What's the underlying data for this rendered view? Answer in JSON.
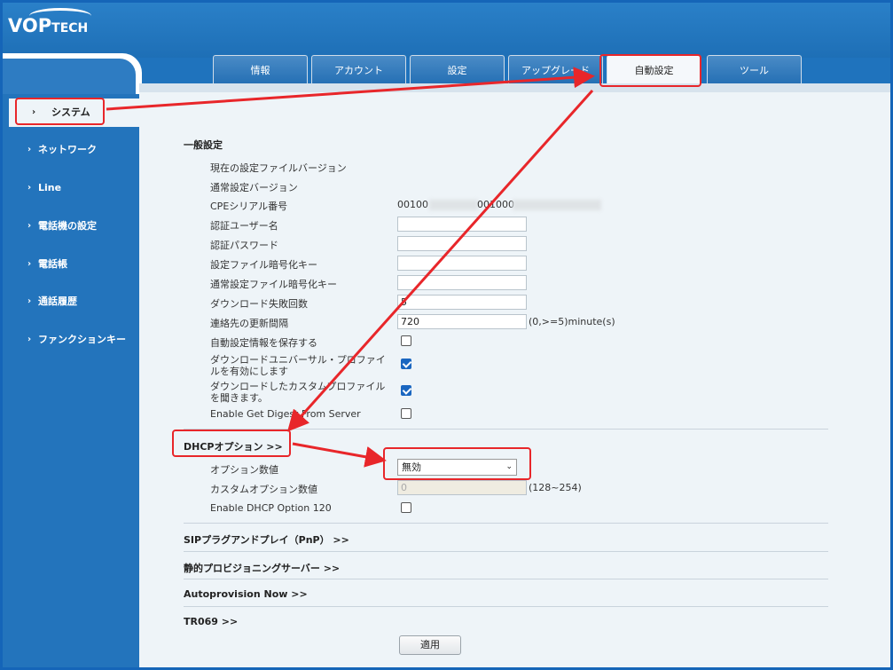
{
  "logo": {
    "main": "VOP",
    "sub": "TECH"
  },
  "tabs": [
    {
      "label": "情報"
    },
    {
      "label": "アカウント"
    },
    {
      "label": "設定"
    },
    {
      "label": "アップグレード"
    },
    {
      "label": "自動設定"
    },
    {
      "label": "ツール"
    }
  ],
  "sidebar": {
    "items": [
      {
        "label": "システム"
      },
      {
        "label": "ネットワーク"
      },
      {
        "label": "Line"
      },
      {
        "label": "電話機の設定"
      },
      {
        "label": "電話帳"
      },
      {
        "label": "通話履歴"
      },
      {
        "label": "ファンクションキー"
      }
    ]
  },
  "general": {
    "title": "一般設定",
    "config_version_label": "現在の設定ファイルバージョン",
    "common_version_label": "通常設定バージョン",
    "cpe_serial_label": "CPEシリアル番号",
    "cpe_serial_value": "00100",
    "cpe_serial_value2": "001000",
    "auth_user_label": "認証ユーザー名",
    "auth_pass_label": "認証パスワード",
    "config_key_label": "設定ファイル暗号化キー",
    "common_key_label": "通常設定ファイル暗号化キー",
    "download_fail_label": "ダウンロード失敗回数",
    "download_fail_value": "5",
    "contact_update_label": "連絡先の更新間隔",
    "contact_update_value": "720",
    "contact_update_hint": "(0,>=5)minute(s)",
    "save_info_label": "自動設定情報を保存する",
    "universal_label_1": "ダウンロードユニバーサル・プロファイ",
    "universal_label_2": "ルを有効にします",
    "custom_label_1": "ダウンロードしたカスタムプロファイル",
    "custom_label_2": "を聞きます。",
    "digest_label": "Enable Get Digest From Server"
  },
  "dhcp": {
    "title": "DHCPオプション >>",
    "option_label": "オプション数値",
    "option_value": "無効",
    "custom_option_label": "カスタムオプション数値",
    "custom_option_value": "0",
    "custom_option_hint": "(128~254)",
    "option120_label": "Enable DHCP Option 120"
  },
  "sections": {
    "sip_pnp": "SIPプラグアンドプレイ（PnP） >>",
    "static_server": "静的プロビジョニングサーバー >>",
    "autoprovision_now": "Autoprovision Now >>",
    "tr069": "TR069 >>"
  },
  "apply_label": "適用",
  "colors": {
    "accent": "#2374bc",
    "highlight": "#e8262a",
    "checkbox": "#1a66c0"
  }
}
